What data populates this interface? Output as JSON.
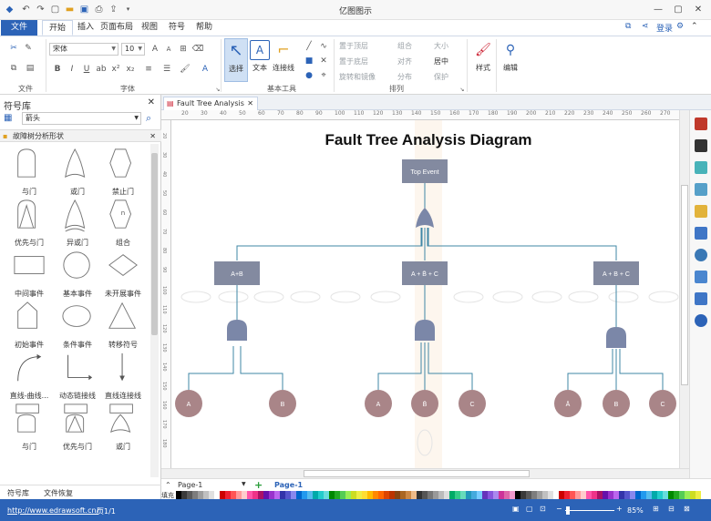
{
  "window": {
    "title": "亿图图示"
  },
  "ribbon": {
    "tabs": [
      "文件",
      "开始",
      "插入",
      "页面布局",
      "视图",
      "符号",
      "帮助"
    ],
    "active_tab": "开始",
    "login": "登录",
    "font": {
      "name": "宋体",
      "size": "10"
    },
    "groups": {
      "file": "文件",
      "font": "字体",
      "basic_tools": "基本工具",
      "arrange": "排列"
    },
    "tools": {
      "select": "选择",
      "text": "文本",
      "connector": "连接线"
    },
    "arrange": {
      "bring_front": "置于顶层",
      "send_back": "置于底层",
      "rotate": "旋转和镜像",
      "group": "组合",
      "size": "大小",
      "align": "对齐",
      "center": "居中",
      "distribute": "分布",
      "protect": "保护"
    },
    "style": "样式",
    "edit": "编辑"
  },
  "library": {
    "title": "符号库",
    "search_value": "箭头",
    "category": "故障树分析形状",
    "shapes": [
      "与门",
      "或门",
      "禁止门",
      "优先与门",
      "异或门",
      "组合",
      "中间事件",
      "基本事件",
      "未开展事件",
      "初始事件",
      "条件事件",
      "转移符号",
      "直线-曲线...",
      "动态链接线",
      "直线连接线",
      "与门",
      "优先与门",
      "或门"
    ],
    "combo_label": "n",
    "bottom_tabs": [
      "符号库",
      "文件恢复"
    ]
  },
  "document": {
    "tab_name": "Fault Tree Analysis",
    "ruler_h": [
      "20",
      "30",
      "40",
      "50",
      "60",
      "70",
      "80",
      "90",
      "100",
      "110",
      "120",
      "130",
      "140",
      "150",
      "160",
      "170",
      "180",
      "190",
      "200",
      "210",
      "220",
      "230",
      "240",
      "250",
      "260",
      "270"
    ],
    "ruler_v": [
      "20",
      "30",
      "40",
      "50",
      "60",
      "70",
      "80",
      "90",
      "100",
      "110",
      "120",
      "130",
      "140",
      "150",
      "160",
      "170",
      "180"
    ]
  },
  "diagram": {
    "title": "Fault Tree Analysis Diagram",
    "top_event": "Top Event",
    "mid_left": "A+B",
    "mid_center": "A + B̄ + C",
    "mid_right": "A + B + C",
    "leaves": [
      "A",
      "B",
      "A",
      "B̄",
      "C",
      "Ā",
      "B",
      "C"
    ],
    "colors": {
      "box": "#838aa0",
      "gate": "#7b87a8",
      "leaf": "#a98588",
      "line": "#3f87a6",
      "title": "#111111"
    }
  },
  "pagebar": {
    "page_select": "Page-1",
    "page_tab": "Page-1",
    "fill_label": "填充"
  },
  "status": {
    "url": "http://www.edrawsoft.cn/",
    "page_info": "页1/1",
    "zoom": "85%"
  }
}
